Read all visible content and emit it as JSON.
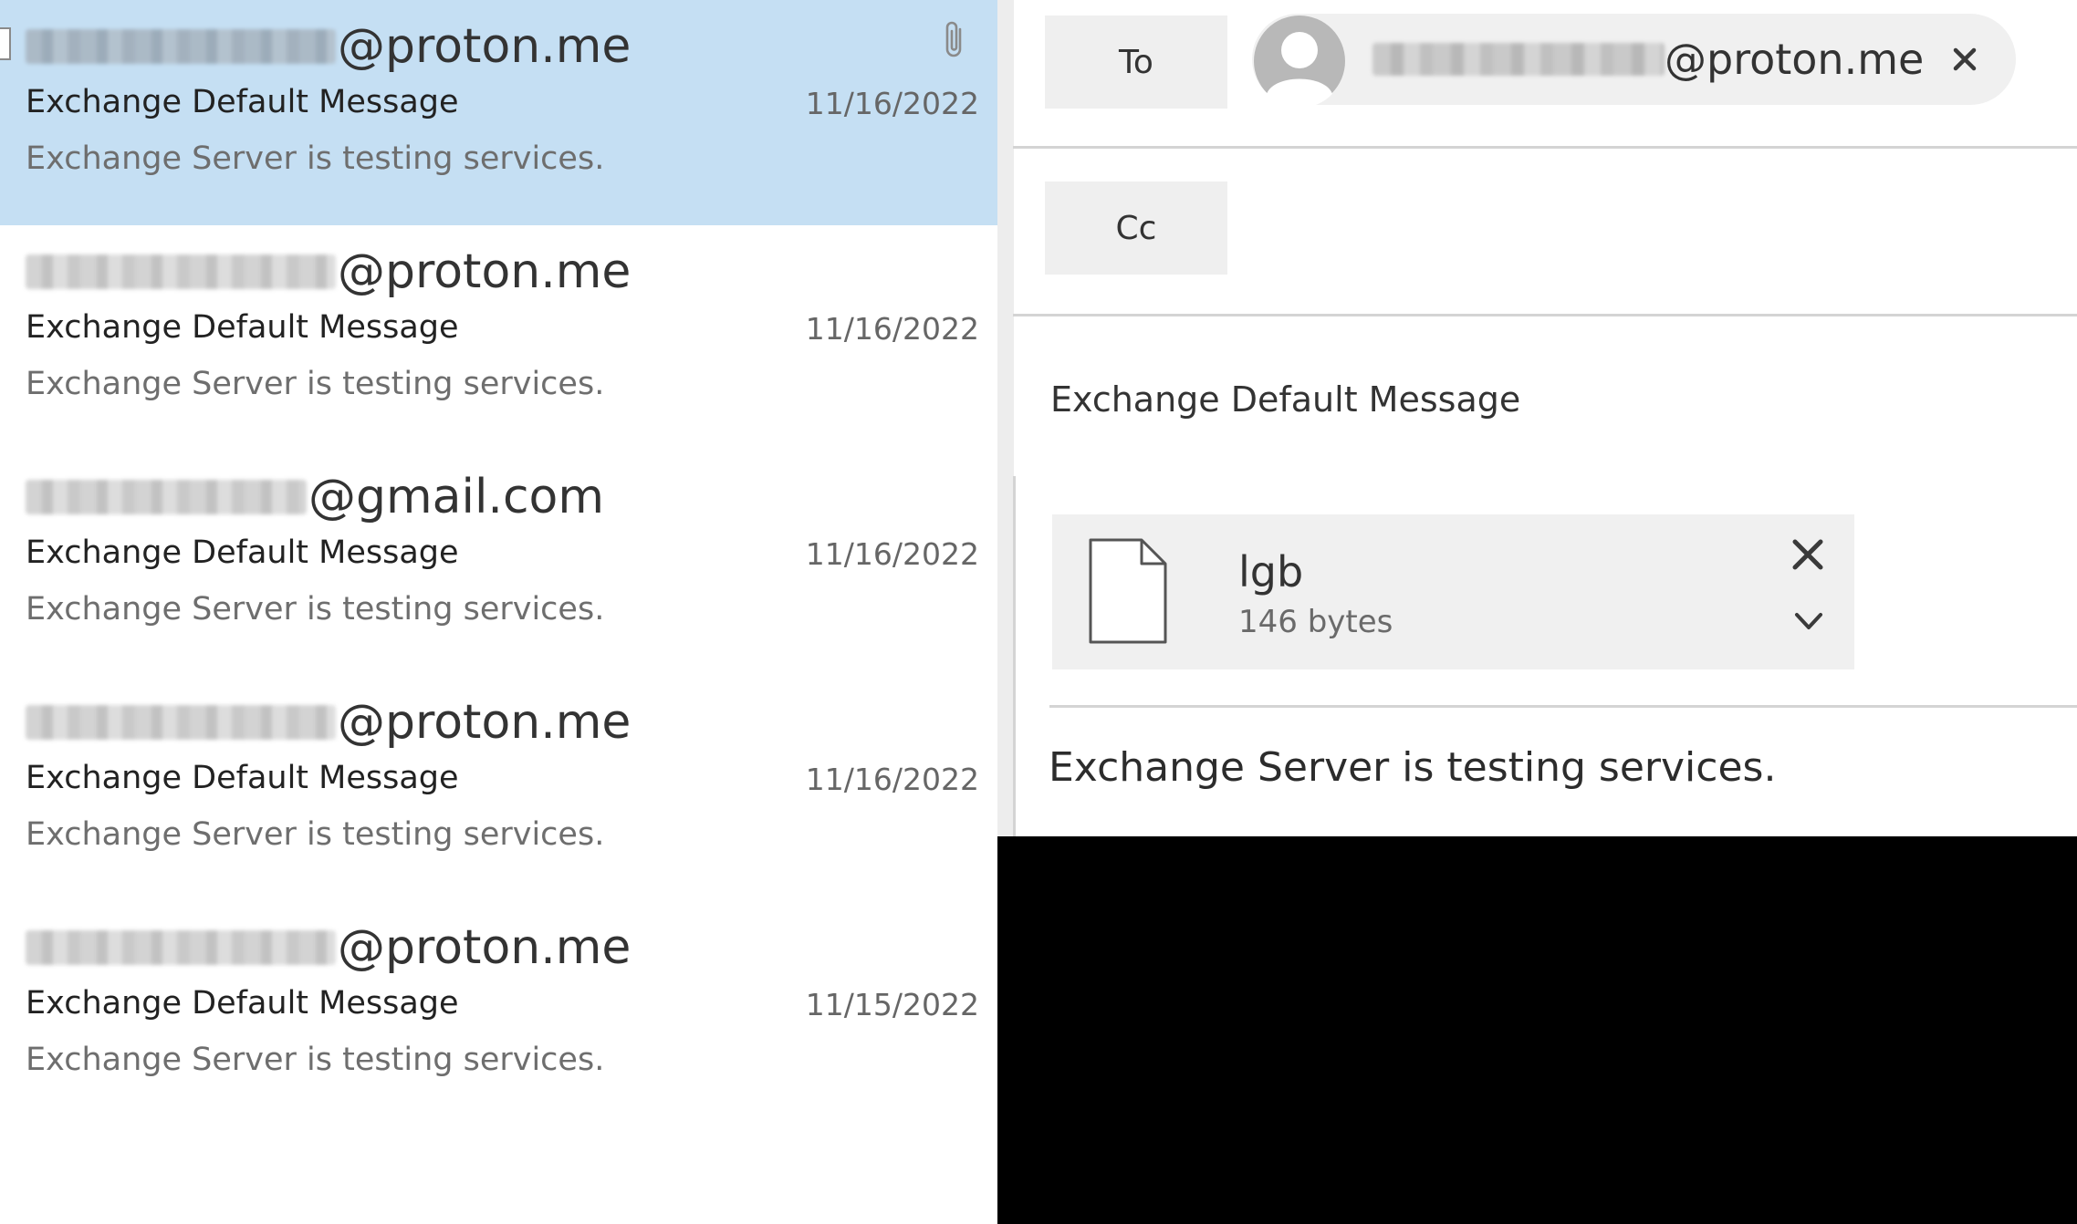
{
  "message_list": {
    "items": [
      {
        "sender_domain": "@proton.me",
        "subject": "Exchange Default Message",
        "date": "11/16/2022",
        "preview": "Exchange Server is testing services.",
        "selected": true,
        "has_attachment": true,
        "attachment_icon": "paperclip-icon"
      },
      {
        "sender_domain": "@proton.me",
        "subject": "Exchange Default Message",
        "date": "11/16/2022",
        "preview": "Exchange Server is testing services.",
        "selected": false,
        "has_attachment": false
      },
      {
        "sender_domain": "@gmail.com",
        "subject": "Exchange Default Message",
        "date": "11/16/2022",
        "preview": "Exchange Server is testing services.",
        "selected": false,
        "has_attachment": false
      },
      {
        "sender_domain": "@proton.me",
        "subject": "Exchange Default Message",
        "date": "11/16/2022",
        "preview": "Exchange Server is testing services.",
        "selected": false,
        "has_attachment": false
      },
      {
        "sender_domain": "@proton.me",
        "subject": "Exchange Default Message",
        "date": "11/15/2022",
        "preview": "Exchange Server is testing services.",
        "selected": false,
        "has_attachment": false
      }
    ]
  },
  "compose": {
    "to_label": "To",
    "cc_label": "Cc",
    "to_recipient": {
      "domain": "@proton.me",
      "avatar_icon": "person-avatar-icon",
      "remove_icon": "close-icon"
    },
    "subject": "Exchange Default Message",
    "attachment": {
      "name": "lgb",
      "size": "146 bytes",
      "file_icon": "document-icon",
      "remove_icon": "close-icon",
      "menu_icon": "chevron-down-icon"
    },
    "body_text": "Exchange Server is testing services."
  },
  "colors": {
    "selected_row": "#c5dff3",
    "field_button": "#efefef",
    "pill": "#f0f0f0",
    "divider": "#d4d4d4",
    "redacted_area": "#000000"
  }
}
